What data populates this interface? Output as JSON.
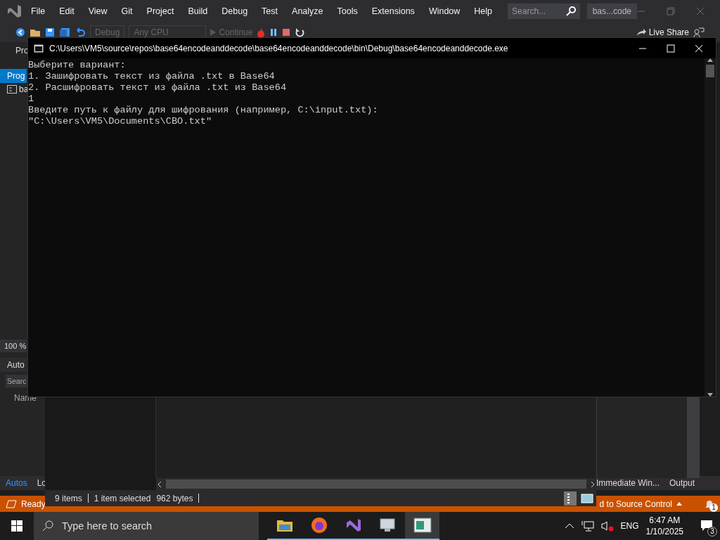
{
  "ide": {
    "menu": [
      "File",
      "Edit",
      "View",
      "Git",
      "Project",
      "Build",
      "Debug",
      "Test",
      "Analyze",
      "Tools",
      "Extensions",
      "Window",
      "Help"
    ],
    "search_placeholder": "Search...",
    "solution_name": "bas...code",
    "toolbar": {
      "configuration": "Debug",
      "platform": "Any CPU",
      "continue": "Continue",
      "live_share": "Live Share"
    },
    "left_panel": {
      "header": "Pro",
      "tab": {
        "label": "Prog",
        "selected": true
      },
      "tree_item": "ba",
      "zoom": "100 %",
      "autos_title": "Auto",
      "search_placeholder": "Searc",
      "column": "Name"
    },
    "bottom_tabs_left": [
      {
        "label": "Autos",
        "selected": true
      },
      {
        "label": "Lo",
        "selected": false
      }
    ],
    "bottom_tabs_right": [
      {
        "label": "Immediate Win...",
        "selected": false
      },
      {
        "label": "Output",
        "selected": false
      }
    ],
    "status": {
      "text": "Ready",
      "source_control": "d to Source Control",
      "notifications": "1"
    }
  },
  "console": {
    "title": "C:\\Users\\VM5\\source\\repos\\base64encodeanddecode\\base64encodeanddecode\\bin\\Debug\\base64encodeanddecode.exe",
    "lines": [
      "Выберите вариант:",
      "1. Зашифровать текст из файла .txt в Base64",
      "2. Расшифровать текст из файла .txt из Base64",
      "1",
      "Введите путь к файлу для шифрования (например, C:\\input.txt):",
      "\"C:\\Users\\VM5\\Documents\\CBO.txt\""
    ]
  },
  "explorer": {
    "item_count": "9 items",
    "selection": "1 item selected",
    "size": "962 bytes"
  },
  "taskbar": {
    "search_placeholder": "Type here to search",
    "apps": [
      {
        "kind": "folder",
        "active": false
      },
      {
        "kind": "browser",
        "active": false
      },
      {
        "kind": "ide",
        "active": false
      },
      {
        "kind": "remote",
        "active": false
      },
      {
        "kind": "console",
        "active": true
      }
    ],
    "language": "ENG",
    "time": "6:47 AM",
    "date": "1/10/2025",
    "notifications": "3"
  }
}
